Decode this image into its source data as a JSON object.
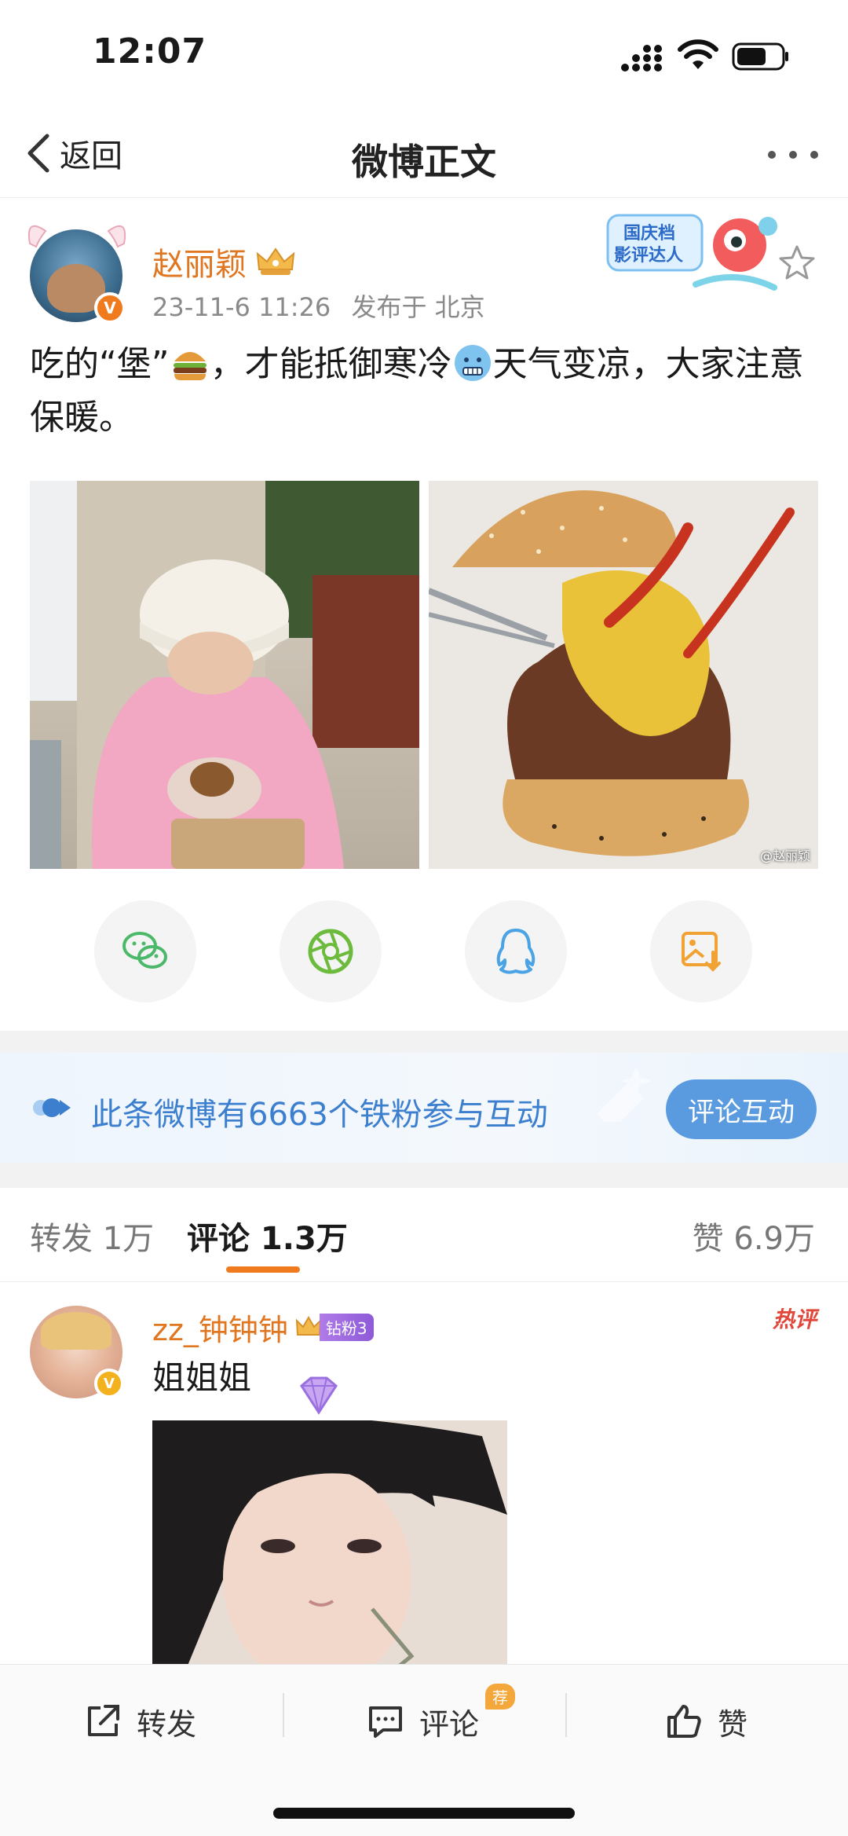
{
  "status_bar": {
    "time": "12:07"
  },
  "nav": {
    "back_label": "返回",
    "title": "微博正文"
  },
  "post": {
    "username": "赵丽颖",
    "verified_badge": "V",
    "timestamp": "23-11-6 11:26",
    "location": "发布于 北京",
    "text_part1": "吃的“堡”",
    "text_part2": "，才能抵御寒冷",
    "text_part3": "天气变凉，大家注意保暖。",
    "promo_badge_text_1": "国庆档",
    "promo_badge_text_2": "影评达人",
    "photo_watermark": "@赵丽颖"
  },
  "share_targets": [
    "wechat-icon",
    "moments-icon",
    "qq-icon",
    "save-image-icon"
  ],
  "fans_banner": {
    "text": "此条微博有6663个铁粉参与互动",
    "button_label": "评论互动"
  },
  "tabs": {
    "repost": "转发 1万",
    "comment": "评论 1.3万",
    "like": "赞 6.9万"
  },
  "comment": {
    "username": "zz_钟钟钟",
    "fan_level": "钻粉3",
    "hot_tag": "热评",
    "badge": "V",
    "text": "姐姐姐"
  },
  "bottom_bar": {
    "repost": "转发",
    "comment": "评论",
    "comment_tag": "荐",
    "like": "赞"
  },
  "colors": {
    "accent_orange": "#f07a1e",
    "link_blue": "#3d7fcf",
    "button_blue": "#5a9be0"
  }
}
